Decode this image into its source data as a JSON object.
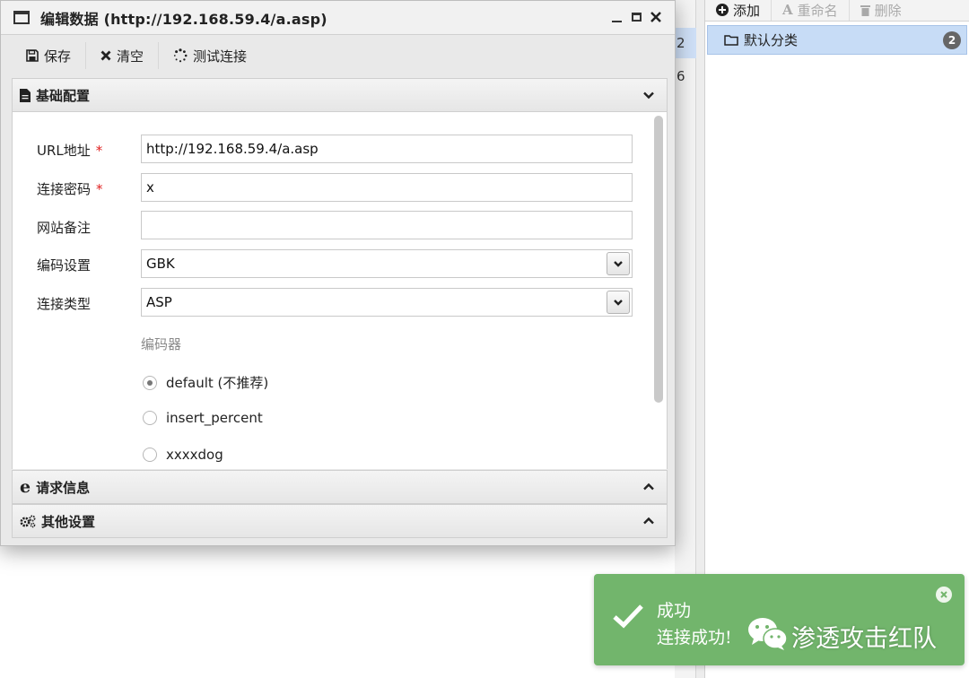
{
  "dialog": {
    "title": "编辑数据 (http://192.168.59.4/a.asp)",
    "toolbar": {
      "save_label": "保存",
      "clear_label": "清空",
      "test_label": "测试连接"
    },
    "sections": {
      "basic": "基础配置",
      "request": "请求信息",
      "other": "其他设置"
    },
    "fields": {
      "url": {
        "label": "URL地址",
        "required_mark": "*",
        "value": "http://192.168.59.4/a.asp"
      },
      "password": {
        "label": "连接密码",
        "required_mark": "*",
        "value": "x"
      },
      "note": {
        "label": "网站备注",
        "value": ""
      },
      "encoding": {
        "label": "编码设置",
        "value": "GBK"
      },
      "type": {
        "label": "连接类型",
        "value": "ASP"
      }
    },
    "encoder": {
      "label": "编码器",
      "options": [
        {
          "label": "default (不推荐)",
          "selected": true
        },
        {
          "label": "insert_percent",
          "selected": false
        },
        {
          "label": "xxxxdog",
          "selected": false
        }
      ]
    }
  },
  "background": {
    "toolbar": {
      "add": "添加",
      "rename": "重命名",
      "delete": "删除"
    },
    "category": {
      "name": "默认分类",
      "count": "2"
    },
    "list_fragments": [
      "2",
      "6"
    ]
  },
  "toast": {
    "title": "成功",
    "message": "连接成功!",
    "watermark": "渗透攻击红队"
  },
  "colors": {
    "toast_bg": "#72b56c",
    "required": "#e02020",
    "selected_row": "#c7dcf6"
  }
}
